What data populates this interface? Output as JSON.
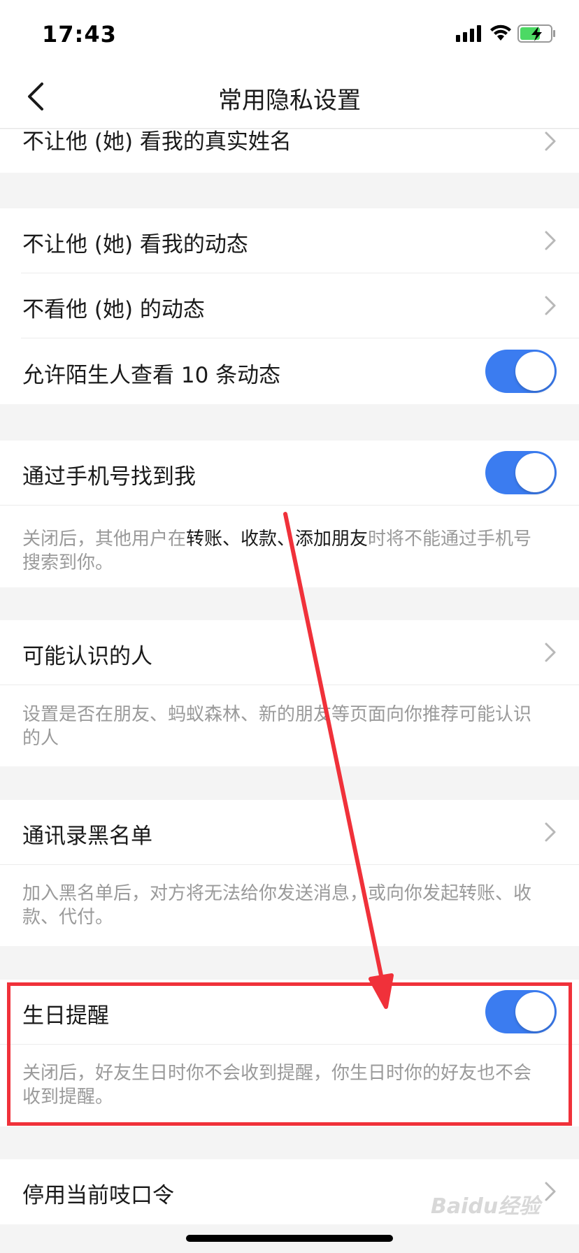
{
  "status_bar": {
    "time": "17:43"
  },
  "nav": {
    "title": "常用隐私设置"
  },
  "rows": {
    "hide_real_name": "不让他 (她) 看我的真实姓名",
    "hide_my_moments": "不让他 (她) 看我的动态",
    "hide_their_moments": "不看他 (她) 的动态",
    "stranger_view": "允许陌生人查看 10 条动态",
    "find_by_phone": "通过手机号找到我",
    "people_may_know": "可能认识的人",
    "blacklist": "通讯录黑名单",
    "birthday_reminder": "生日提醒",
    "disable_password": "停用当前吱口令"
  },
  "descriptions": {
    "find_by_phone": {
      "prefix": "关闭后，其他用户在",
      "highlight": "转账、收款、添加朋友",
      "suffix": "时将不能通过手机号搜索到你。"
    },
    "people_may_know": "设置是否在朋友、蚂蚁森林、新的朋友等页面向你推荐可能认识的人",
    "blacklist": "加入黑名单后，对方将无法给你发送消息，或向你发起转账、收款、代付。",
    "birthday_reminder": "关闭后，好友生日时你不会收到提醒，你生日时你的好友也不会收到提醒。"
  },
  "toggles": {
    "stranger_view": true,
    "find_by_phone": true,
    "birthday_reminder": true
  },
  "watermark": "Baidu经验",
  "colors": {
    "toggle_on": "#3b7cf0",
    "annotation": "#f0313a"
  }
}
